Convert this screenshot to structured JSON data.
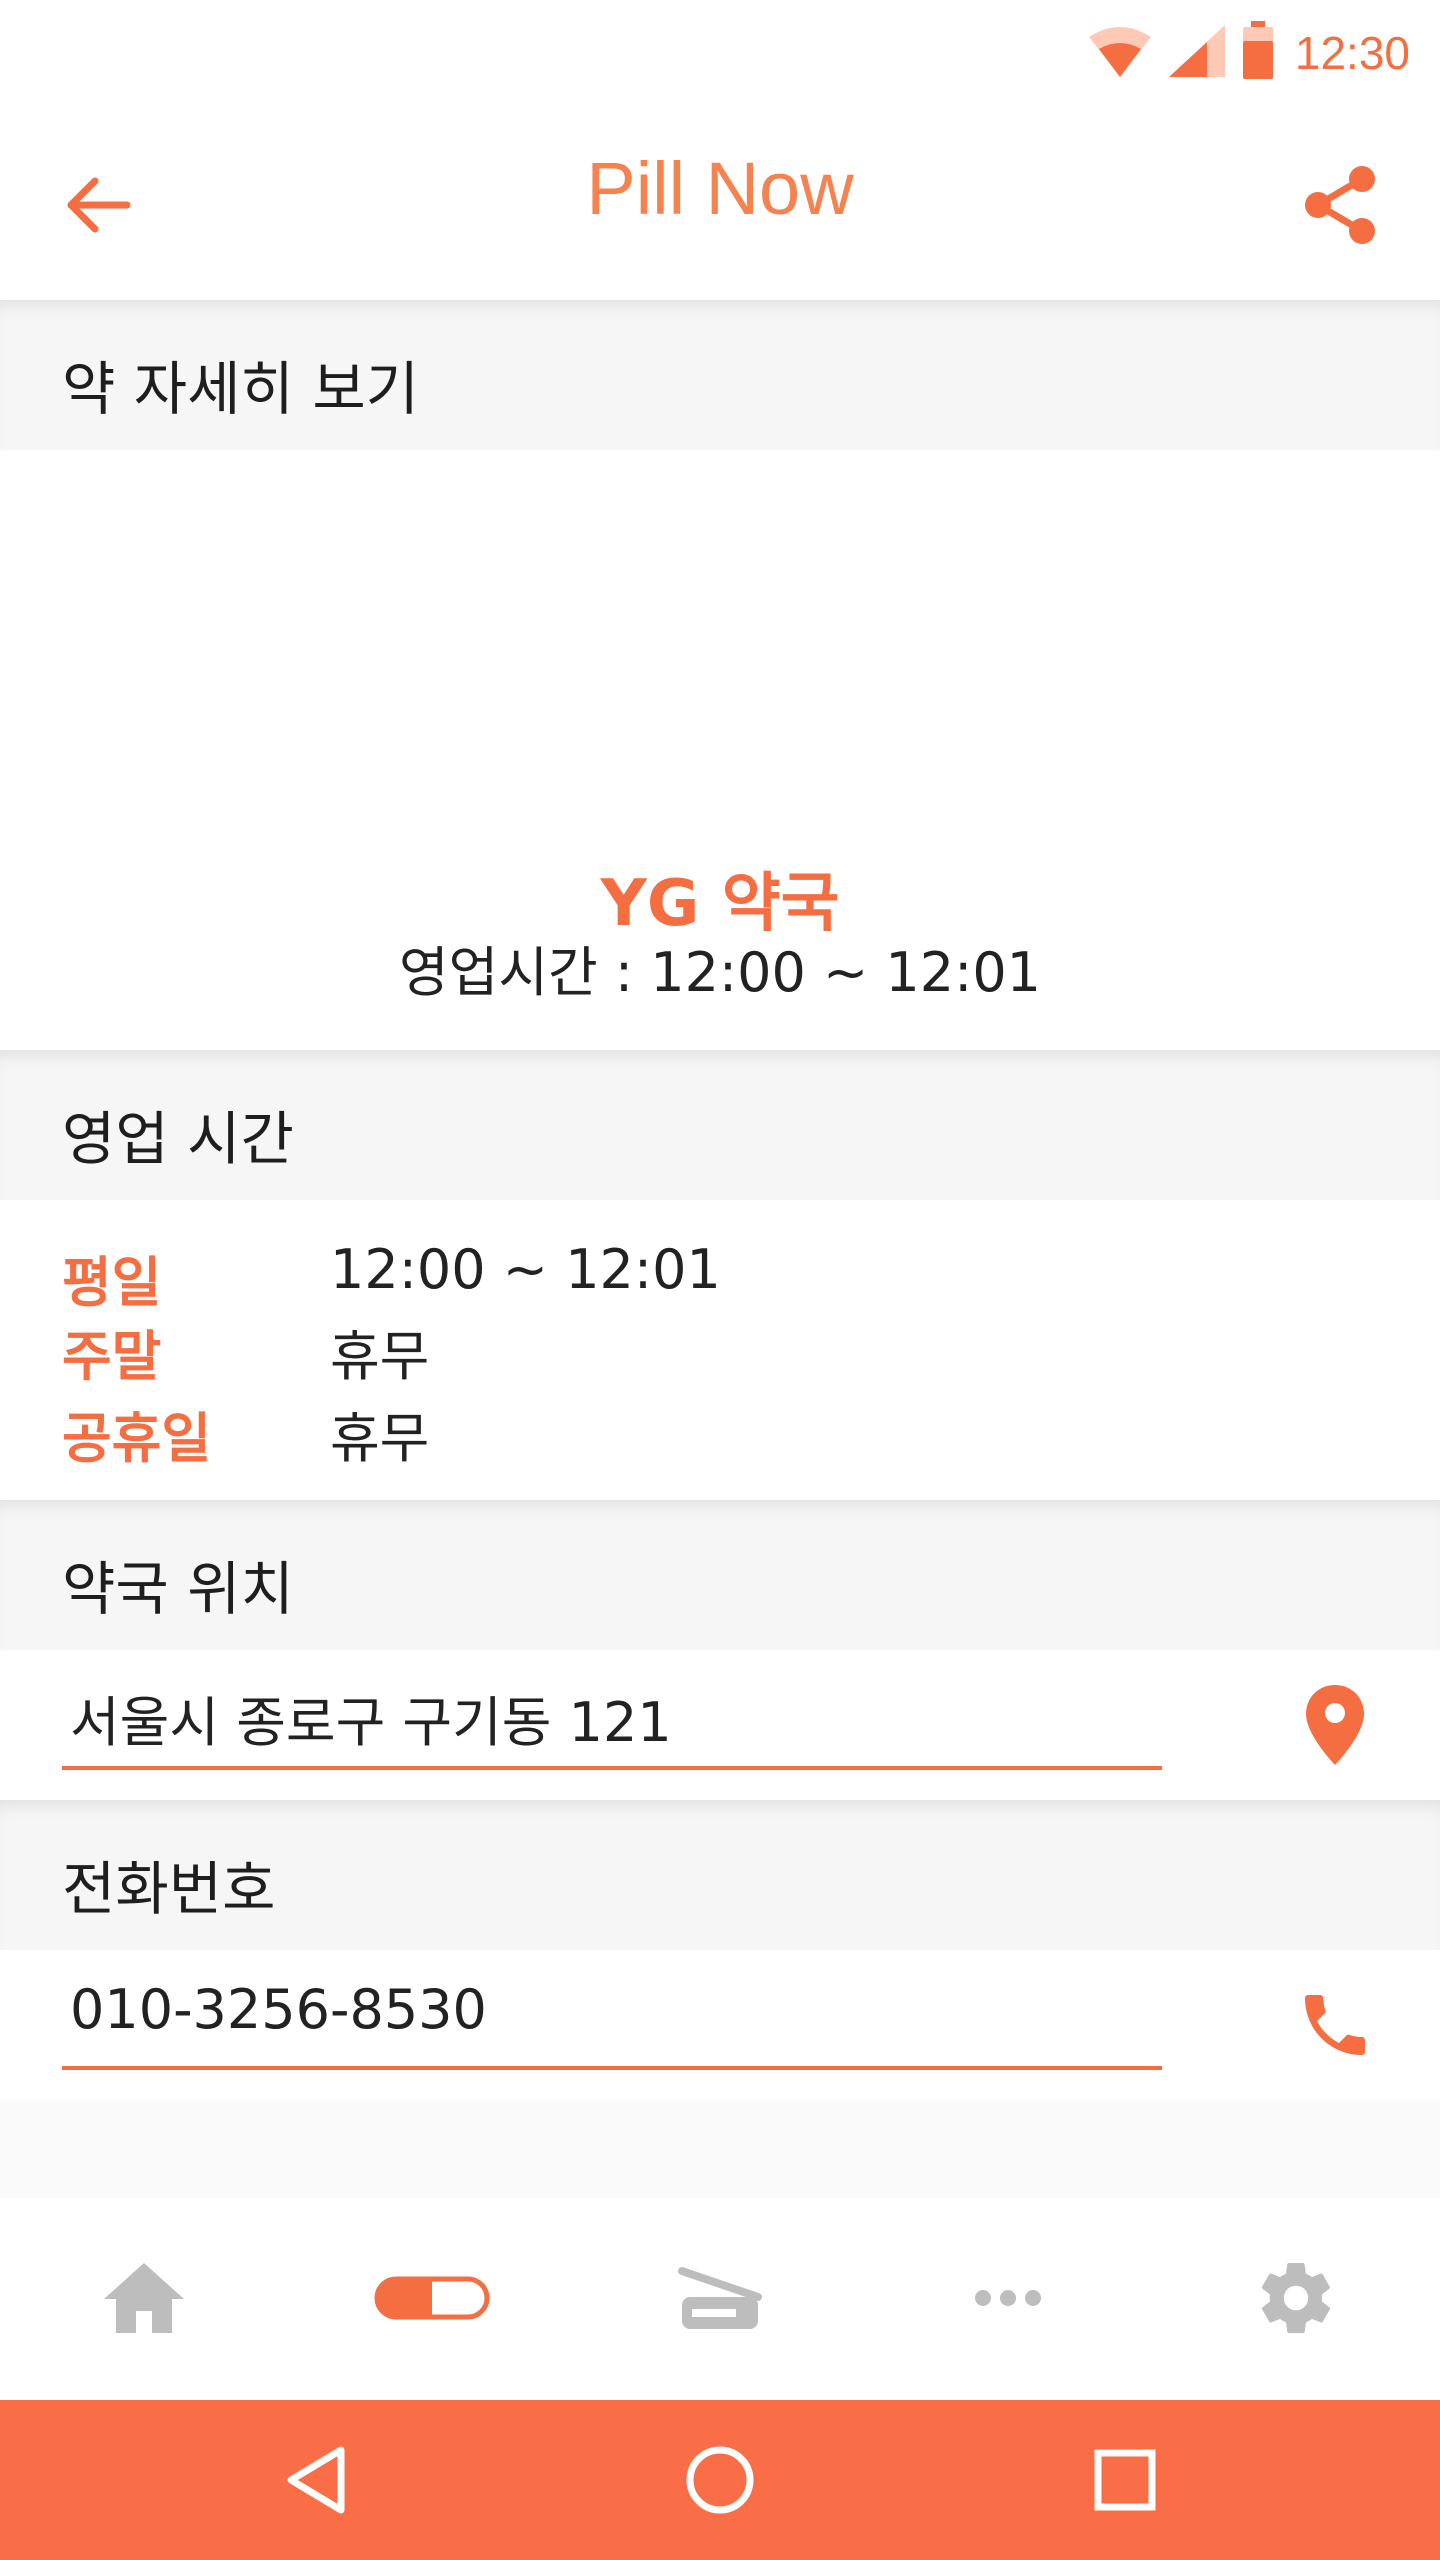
{
  "status_bar": {
    "time": "12:30",
    "icons": [
      "wifi-icon",
      "signal-icon",
      "battery-icon"
    ]
  },
  "app_bar": {
    "title": "Pill Now",
    "back_icon": "arrow-left-icon",
    "share_icon": "share-icon"
  },
  "sections": {
    "detail_header": "약 자세히 보기",
    "hours_header": "영업 시간",
    "location_header": "약국 위치",
    "phone_header": "전화번호"
  },
  "pharmacy": {
    "name": "YG 약국",
    "hours_summary": "영업시간 : 12:00 ~ 12:01"
  },
  "hours": [
    {
      "label": "평일",
      "value": "12:00 ~ 12:01"
    },
    {
      "label": "주말",
      "value": "휴무"
    },
    {
      "label": "공휴일",
      "value": "휴무"
    }
  ],
  "location": {
    "address": "서울시 종로구 구기동 121",
    "icon": "map-pin-icon"
  },
  "phone": {
    "number": "010-3256-8530",
    "icon": "phone-icon"
  },
  "bottom_nav": [
    {
      "name": "home-icon",
      "active": false
    },
    {
      "name": "pill-icon",
      "active": true
    },
    {
      "name": "scanner-icon",
      "active": false
    },
    {
      "name": "more-icon",
      "active": false
    },
    {
      "name": "gear-icon",
      "active": false
    }
  ],
  "colors": {
    "accent": "#f56e41",
    "inactive": "#bdbdbd",
    "system_nav": "#f96e46"
  }
}
